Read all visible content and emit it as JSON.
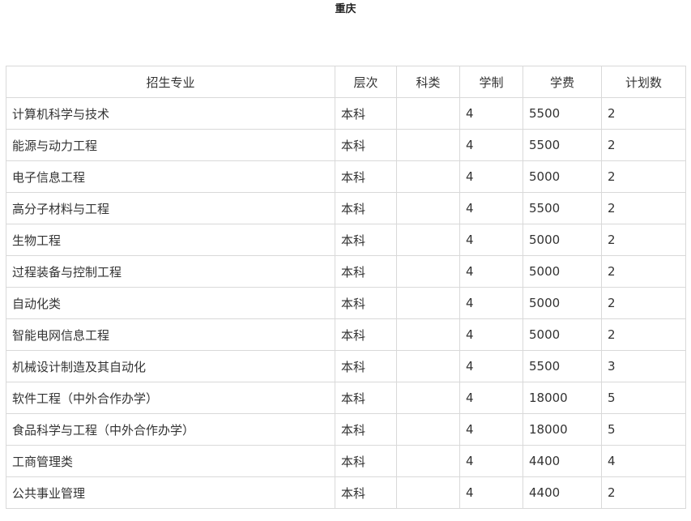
{
  "title": "重庆",
  "table": {
    "headers": [
      "招生专业",
      "层次",
      "科类",
      "学制",
      "学费",
      "计划数"
    ],
    "rows": [
      [
        "计算机科学与技术",
        "本科",
        "",
        "4",
        "5500",
        "2"
      ],
      [
        "能源与动力工程",
        "本科",
        "",
        "4",
        "5500",
        "2"
      ],
      [
        "电子信息工程",
        "本科",
        "",
        "4",
        "5000",
        "2"
      ],
      [
        "高分子材料与工程",
        "本科",
        "",
        "4",
        "5500",
        "2"
      ],
      [
        "生物工程",
        "本科",
        "",
        "4",
        "5000",
        "2"
      ],
      [
        "过程装备与控制工程",
        "本科",
        "",
        "4",
        "5000",
        "2"
      ],
      [
        "自动化类",
        "本科",
        "",
        "4",
        "5000",
        "2"
      ],
      [
        "智能电网信息工程",
        "本科",
        "",
        "4",
        "5000",
        "2"
      ],
      [
        "机械设计制造及其自动化",
        "本科",
        "",
        "4",
        "5500",
        "3"
      ],
      [
        "软件工程（中外合作办学）",
        "本科",
        "",
        "4",
        "18000",
        "5"
      ],
      [
        "食品科学与工程（中外合作办学）",
        "本科",
        "",
        "4",
        "18000",
        "5"
      ],
      [
        "工商管理类",
        "本科",
        "",
        "4",
        "4400",
        "4"
      ],
      [
        "公共事业管理",
        "本科",
        "",
        "4",
        "4400",
        "2"
      ]
    ]
  }
}
